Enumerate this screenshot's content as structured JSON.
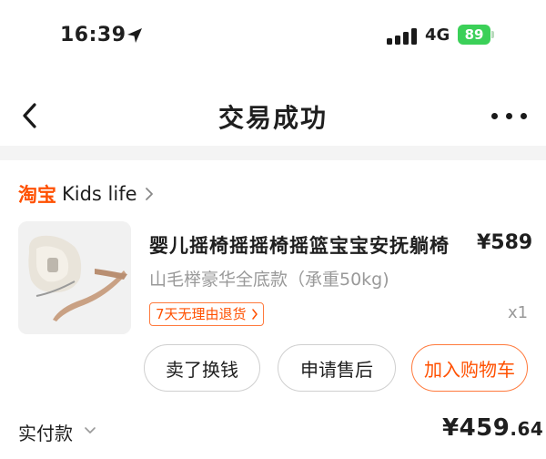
{
  "status_bar": {
    "time": "16:39",
    "network": "4G",
    "battery": "89"
  },
  "nav": {
    "title": "交易成功"
  },
  "shop": {
    "platform_logo": "淘宝",
    "name": "Kids life"
  },
  "product": {
    "title": "婴儿摇椅摇摇椅摇篮宝宝安抚躺椅",
    "price": "¥589",
    "sku": "山毛榉豪华全底款（承重50kg)",
    "return_badge": "7天无理由退货",
    "quantity": "x1"
  },
  "actions": {
    "sell_label": "卖了换钱",
    "aftersale_label": "申请售后",
    "add_cart_label": "加入购物车"
  },
  "payment": {
    "label": "实付款",
    "amount_int": "¥459",
    "amount_dec": ".64"
  },
  "colors": {
    "accent": "#ff5000",
    "battery": "#3bd058"
  }
}
